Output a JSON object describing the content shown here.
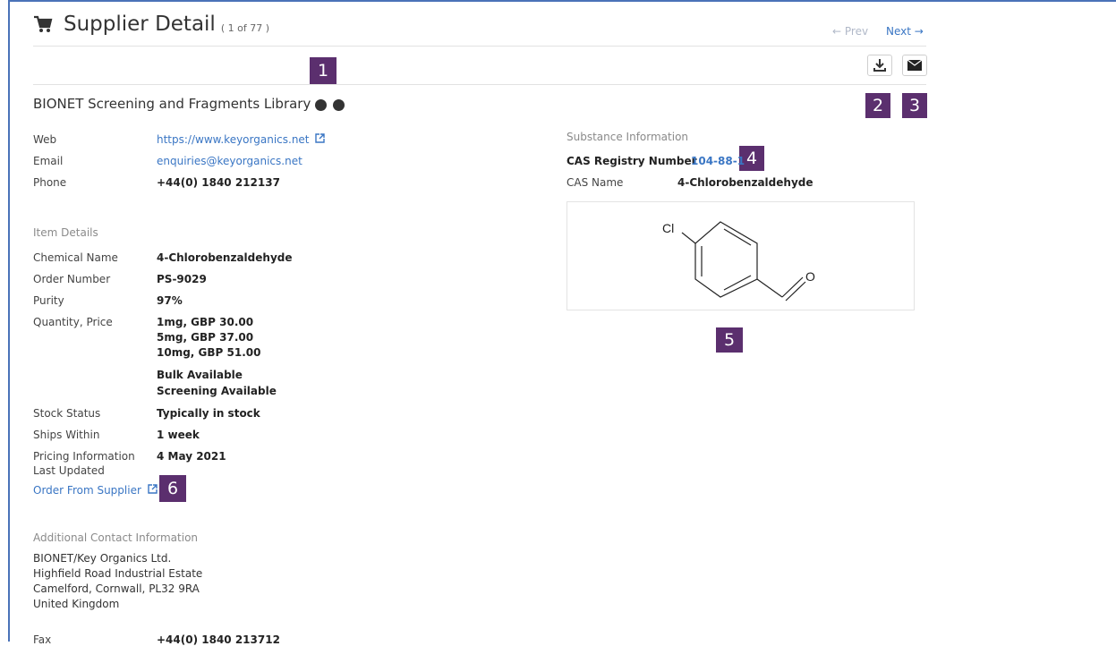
{
  "header": {
    "title": "Supplier Detail",
    "counter": "( 1 of 77 )",
    "prev_label": "← Prev",
    "next_label": "Next →"
  },
  "toolbar": {
    "download_icon": "download-icon",
    "email_icon": "envelope-icon"
  },
  "supplier": {
    "name": "BIONET Screening and Fragments Library",
    "contacts": [
      {
        "label": "Web",
        "value": "https://www.keyorganics.net"
      },
      {
        "label": "Email",
        "value": "enquiries@keyorganics.net"
      },
      {
        "label": "Phone",
        "value": "+44(0) 1840 212137"
      }
    ]
  },
  "item_details": {
    "heading": "Item Details",
    "chemical_name_label": "Chemical Name",
    "chemical_name": "4-Chlorobenzaldehyde",
    "order_number_label": "Order Number",
    "order_number": "PS-9029",
    "purity_label": "Purity",
    "purity": "97%",
    "quantity_label": "Quantity, Price",
    "prices": [
      "1mg, GBP 30.00",
      "5mg, GBP 37.00",
      "10mg, GBP 51.00"
    ],
    "availability": [
      "Bulk Available",
      "Screening Available"
    ],
    "stock_label": "Stock Status",
    "stock": "Typically in stock",
    "ships_label": "Ships Within",
    "ships": "1 week",
    "pricing_label_1": "Pricing Information",
    "pricing_label_2": "Last Updated",
    "pricing_date": "4 May 2021",
    "order_link": "Order From Supplier"
  },
  "additional_contact": {
    "heading": "Additional Contact Information",
    "lines": [
      "BIONET/Key Organics Ltd.",
      "Highfield Road Industrial Estate",
      "Camelford, Cornwall, PL32 9RA",
      "United Kingdom"
    ],
    "fax_label": "Fax",
    "fax": "+44(0) 1840 213712"
  },
  "substance": {
    "heading": "Substance Information",
    "cas_label": "CAS Registry Number",
    "cas_number": "104-88-1",
    "cas_name_label": "CAS Name",
    "cas_name": "4-Chlorobenzaldehyde",
    "structure_atoms": {
      "cl": "Cl",
      "o": "O"
    }
  },
  "callouts": [
    "1",
    "2",
    "3",
    "4",
    "5",
    "6"
  ],
  "colors": {
    "callout": "#5b2f6e",
    "link": "#3a76c4",
    "frame": "#4a72b8"
  }
}
